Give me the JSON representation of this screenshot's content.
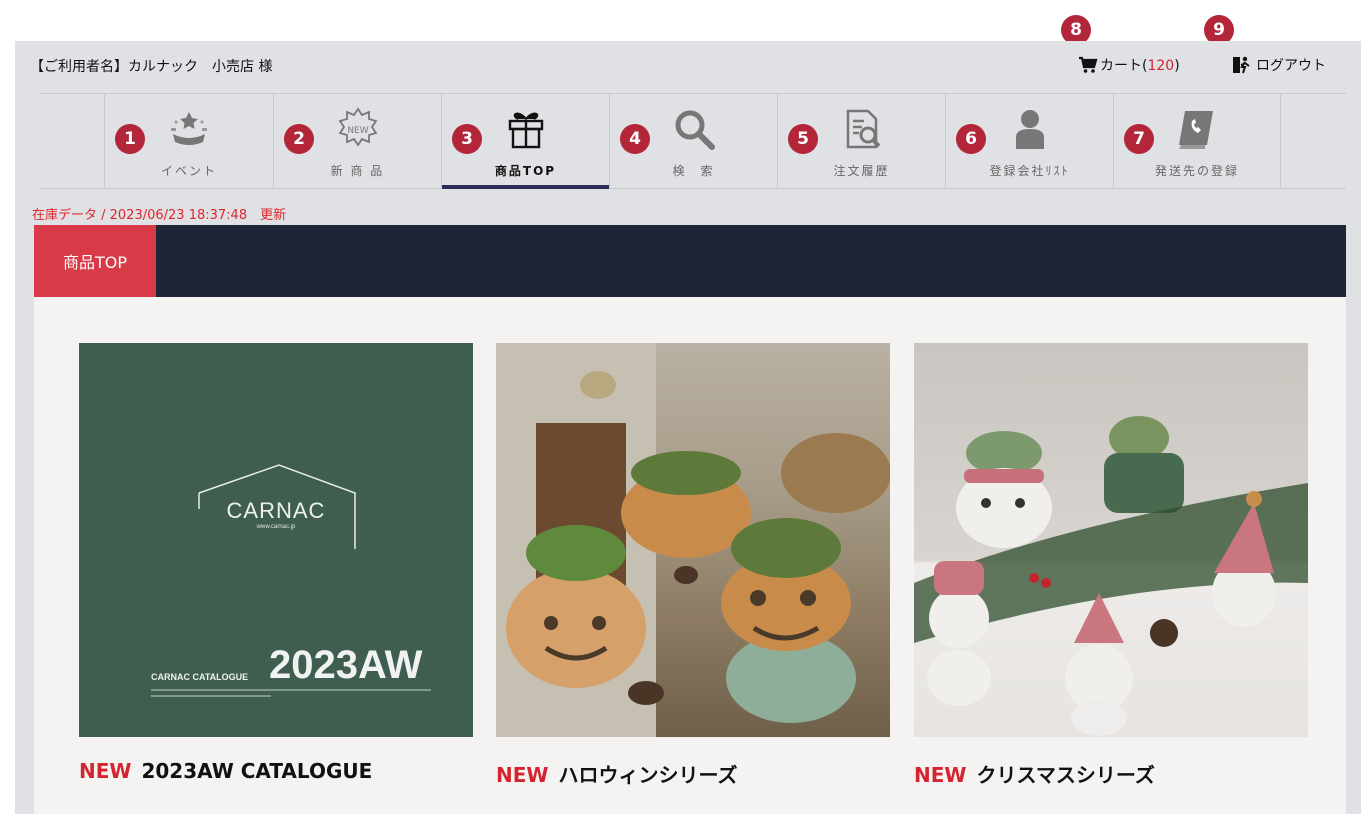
{
  "header": {
    "user_label": "【ご利用者名】カルナック　小売店 様",
    "cart_label": "カート(",
    "cart_count": "120",
    "cart_close": ")",
    "logout_label": "ログアウト",
    "cart_badge": "8",
    "logout_badge": "9"
  },
  "nav": {
    "items": [
      {
        "num": "1",
        "label": "イベント"
      },
      {
        "num": "2",
        "label": "新 商 品"
      },
      {
        "num": "3",
        "label": "商品TOP"
      },
      {
        "num": "4",
        "label": "検　索"
      },
      {
        "num": "5",
        "label": "注文履歴"
      },
      {
        "num": "6",
        "label": "登録会社ﾘｽﾄ"
      },
      {
        "num": "7",
        "label": "発送先の登録"
      }
    ],
    "active_index": 2
  },
  "stock_line": "在庫データ / 2023/06/23 18:37:48　更新",
  "page_title": "商品TOP",
  "catalogue_image": {
    "brand": "CARNAC",
    "url": "www.carnac.jp",
    "catalogue_label": "CARNAC CATALOGUE",
    "season": "2023AW"
  },
  "cards": [
    {
      "new_label": "NEW",
      "title": "2023AW CATALOGUE"
    },
    {
      "new_label": "NEW",
      "title": "ハロウィンシリーズ"
    },
    {
      "new_label": "NEW",
      "title": "クリスマスシリーズ"
    }
  ],
  "colors": {
    "accent_red": "#d3242f",
    "badge_red": "#b3263a",
    "title_bar": "#1f2436",
    "title_tab": "#d83a47",
    "active_underline": "#2b2f57"
  }
}
